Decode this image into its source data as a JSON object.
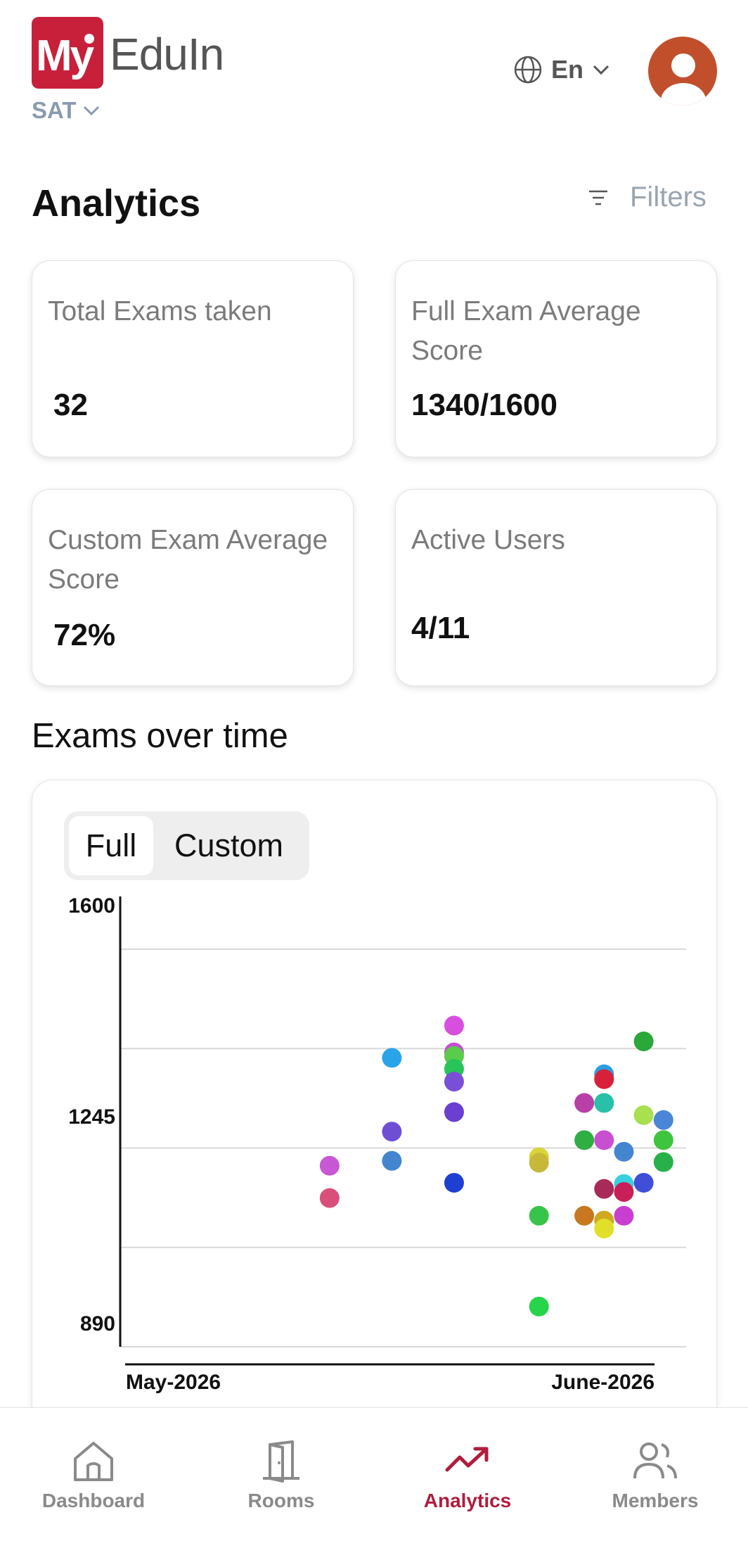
{
  "header": {
    "logo_my": "My",
    "logo_text": "EduIn",
    "exam_selector": "SAT",
    "language": "En"
  },
  "page": {
    "title": "Analytics",
    "filters_label": "Filters"
  },
  "cards": [
    {
      "label": "Total Exams taken",
      "value": "32"
    },
    {
      "label": "Full Exam Average Score",
      "value": "1340/1600"
    },
    {
      "label": "Custom Exam Average Score",
      "value": "72%"
    },
    {
      "label": "Active Users",
      "value": "4/11"
    }
  ],
  "exams_section": {
    "title": "Exams over time",
    "toggle": {
      "options": [
        "Full",
        "Custom"
      ],
      "selected": "Full"
    }
  },
  "chart_data": {
    "type": "scatter",
    "title": "",
    "xlabel": "",
    "ylabel": "",
    "y_ticks": [
      "1600",
      "1245",
      "890"
    ],
    "ylim": [
      890,
      1600
    ],
    "x_ticks": [
      "May-2026",
      "June-2026"
    ],
    "grid": true,
    "legend": "none",
    "points": [
      {
        "x": 0.37,
        "y": 1187,
        "color": "#c857d6"
      },
      {
        "x": 0.37,
        "y": 1134,
        "color": "#d84f7a"
      },
      {
        "x": 0.48,
        "y": 1364,
        "color": "#2aa4e8"
      },
      {
        "x": 0.48,
        "y": 1243,
        "color": "#6e4fd4"
      },
      {
        "x": 0.48,
        "y": 1195,
        "color": "#4386cf"
      },
      {
        "x": 0.59,
        "y": 1417,
        "color": "#d84fe0"
      },
      {
        "x": 0.59,
        "y": 1373,
        "color": "#c44fd4"
      },
      {
        "x": 0.59,
        "y": 1367,
        "color": "#5acb4a"
      },
      {
        "x": 0.59,
        "y": 1346,
        "color": "#28c45a"
      },
      {
        "x": 0.59,
        "y": 1325,
        "color": "#7a4fd8"
      },
      {
        "x": 0.59,
        "y": 1275,
        "color": "#6b3fd0"
      },
      {
        "x": 0.59,
        "y": 1159,
        "color": "#1f3fd0"
      },
      {
        "x": 0.74,
        "y": 1201,
        "color": "#d8d43a"
      },
      {
        "x": 0.74,
        "y": 1192,
        "color": "#c8b83a"
      },
      {
        "x": 0.74,
        "y": 1105,
        "color": "#38c44a"
      },
      {
        "x": 0.74,
        "y": 956,
        "color": "#28d44a"
      },
      {
        "x": 0.82,
        "y": 1290,
        "color": "#b83fa8"
      },
      {
        "x": 0.82,
        "y": 1229,
        "color": "#2fae42"
      },
      {
        "x": 0.82,
        "y": 1105,
        "color": "#c8781f"
      },
      {
        "x": 0.855,
        "y": 1337,
        "color": "#2a9ee0"
      },
      {
        "x": 0.855,
        "y": 1329,
        "color": "#d8203a"
      },
      {
        "x": 0.855,
        "y": 1290,
        "color": "#28c0a8"
      },
      {
        "x": 0.855,
        "y": 1229,
        "color": "#c84fd0"
      },
      {
        "x": 0.855,
        "y": 1149,
        "color": "#a82a58"
      },
      {
        "x": 0.855,
        "y": 1097,
        "color": "#d0a81f"
      },
      {
        "x": 0.855,
        "y": 1084,
        "color": "#e0e02a"
      },
      {
        "x": 0.89,
        "y": 1210,
        "color": "#4386cf"
      },
      {
        "x": 0.89,
        "y": 1157,
        "color": "#38d0e0"
      },
      {
        "x": 0.89,
        "y": 1144,
        "color": "#c81f58"
      },
      {
        "x": 0.89,
        "y": 1105,
        "color": "#c83fd0"
      },
      {
        "x": 0.925,
        "y": 1391,
        "color": "#2aa83a"
      },
      {
        "x": 0.925,
        "y": 1270,
        "color": "#a8e050"
      },
      {
        "x": 0.925,
        "y": 1159,
        "color": "#3f4fd8"
      },
      {
        "x": 0.96,
        "y": 1262,
        "color": "#4a86d8"
      },
      {
        "x": 0.96,
        "y": 1229,
        "color": "#3fc43f"
      },
      {
        "x": 0.96,
        "y": 1193,
        "color": "#28b04a"
      }
    ]
  },
  "nav": {
    "items": [
      {
        "label": "Dashboard",
        "icon": "home-icon"
      },
      {
        "label": "Rooms",
        "icon": "door-icon"
      },
      {
        "label": "Analytics",
        "icon": "trending-up-icon"
      },
      {
        "label": "Members",
        "icon": "users-icon"
      }
    ],
    "active": "Analytics",
    "active_color": "#b01c3c",
    "inactive_color": "#8a8a8a"
  }
}
